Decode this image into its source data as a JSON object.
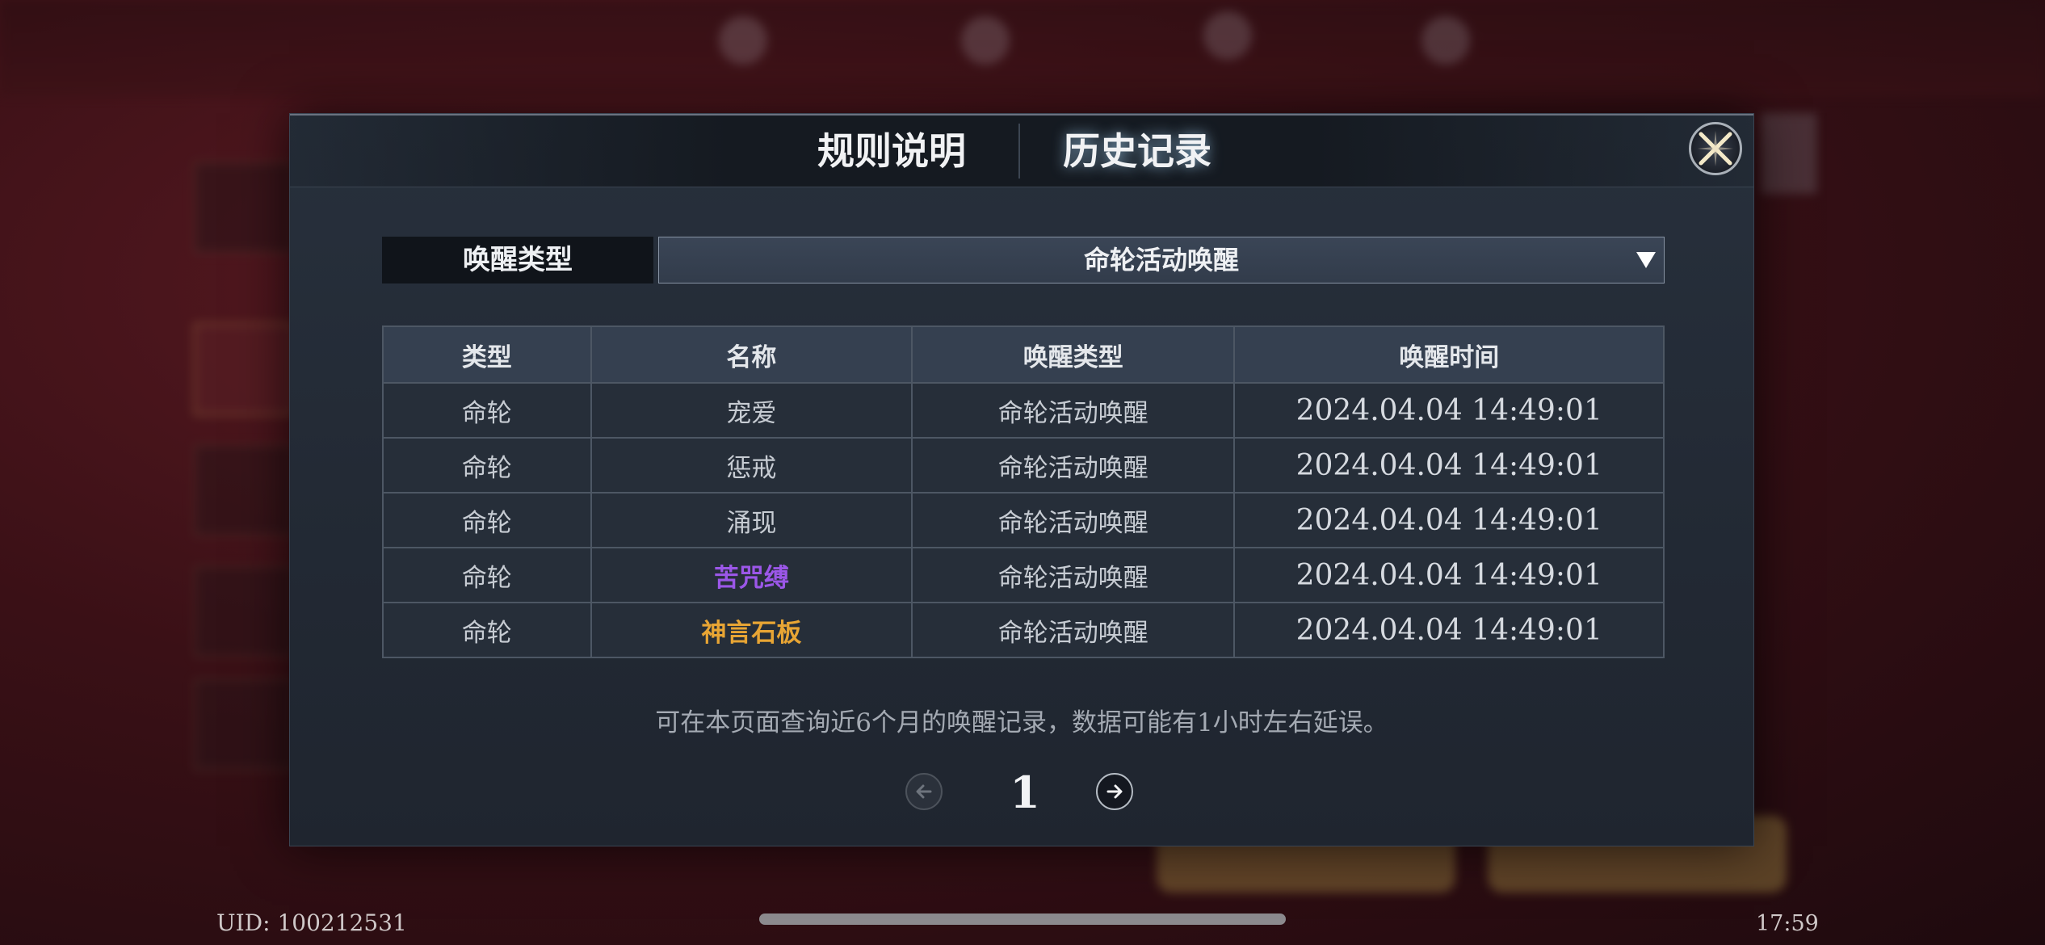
{
  "tabs": [
    {
      "label": "规则说明",
      "active": false
    },
    {
      "label": "历史记录",
      "active": true
    }
  ],
  "filter": {
    "label": "唤醒类型",
    "selected": "命轮活动唤醒"
  },
  "table": {
    "headers": [
      "类型",
      "名称",
      "唤醒类型",
      "唤醒时间"
    ],
    "rows": [
      {
        "type": "命轮",
        "name": "宠爱",
        "wake_type": "命轮活动唤醒",
        "time": "2024.04.04 14:49:01",
        "rarity_color": "#c7ccd3"
      },
      {
        "type": "命轮",
        "name": "惩戒",
        "wake_type": "命轮活动唤醒",
        "time": "2024.04.04 14:49:01",
        "rarity_color": "#c7ccd3"
      },
      {
        "type": "命轮",
        "name": "涌现",
        "wake_type": "命轮活动唤醒",
        "time": "2024.04.04 14:49:01",
        "rarity_color": "#c7ccd3"
      },
      {
        "type": "命轮",
        "name": "苦咒缚",
        "wake_type": "命轮活动唤醒",
        "time": "2024.04.04 14:49:01",
        "rarity_color": "#9b57e8"
      },
      {
        "type": "命轮",
        "name": "神言石板",
        "wake_type": "命轮活动唤醒",
        "time": "2024.04.04 14:49:01",
        "rarity_color": "#e8a534"
      }
    ]
  },
  "notice": "可在本页面查询近6个月的唤醒记录，数据可能有1小时左右延误。",
  "pagination": {
    "current_page": "1"
  },
  "footer": {
    "uid": "UID: 100212531",
    "clock": "17:59"
  },
  "icons": {
    "close": "close-x-icon",
    "prev": "arrow-left-icon",
    "next": "arrow-right-icon",
    "dropdown": "caret-down-icon"
  }
}
